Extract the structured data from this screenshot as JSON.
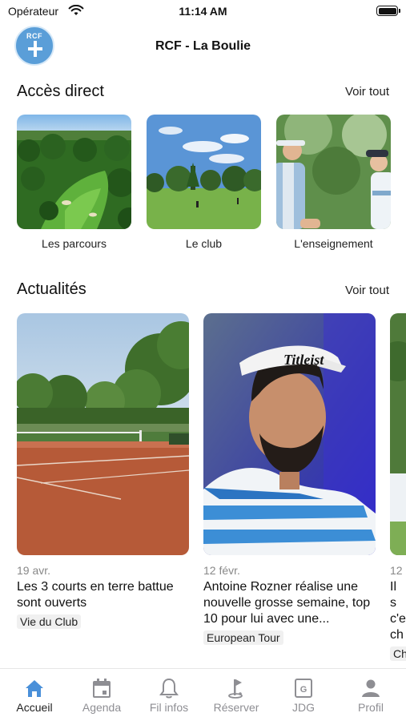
{
  "status_bar": {
    "carrier": "Opérateur",
    "time": "11:14 AM"
  },
  "header": {
    "logo_text": "RCF",
    "title": "RCF - La Boulie"
  },
  "quick_access": {
    "title": "Accès direct",
    "see_all": "Voir tout",
    "items": [
      {
        "label": "Les parcours"
      },
      {
        "label": "Le club"
      },
      {
        "label": "L'enseignement"
      }
    ]
  },
  "news": {
    "title": "Actualités",
    "see_all": "Voir tout",
    "items": [
      {
        "date": "19 avr.",
        "title": "Les 3 courts en terre battue sont ouverts",
        "tag": "Vie du Club"
      },
      {
        "date": "12 févr.",
        "title": "Antoine Rozner réalise une nouvelle grosse semaine, top 10 pour lui avec une...",
        "tag": "European Tour"
      },
      {
        "date": "12",
        "title": "Il s c'e ch",
        "tag": "Ch"
      }
    ]
  },
  "tab_bar": {
    "active": "Accueil",
    "accent_color": "#4a90d9",
    "inactive_color": "#8e8e93",
    "items": [
      {
        "label": "Accueil",
        "icon": "home-icon"
      },
      {
        "label": "Agenda",
        "icon": "calendar-icon"
      },
      {
        "label": "Fil infos",
        "icon": "bell-icon"
      },
      {
        "label": "Réserver",
        "icon": "golf-flag-icon"
      },
      {
        "label": "JDG",
        "icon": "jdg-icon"
      },
      {
        "label": "Profil",
        "icon": "person-icon"
      }
    ]
  }
}
